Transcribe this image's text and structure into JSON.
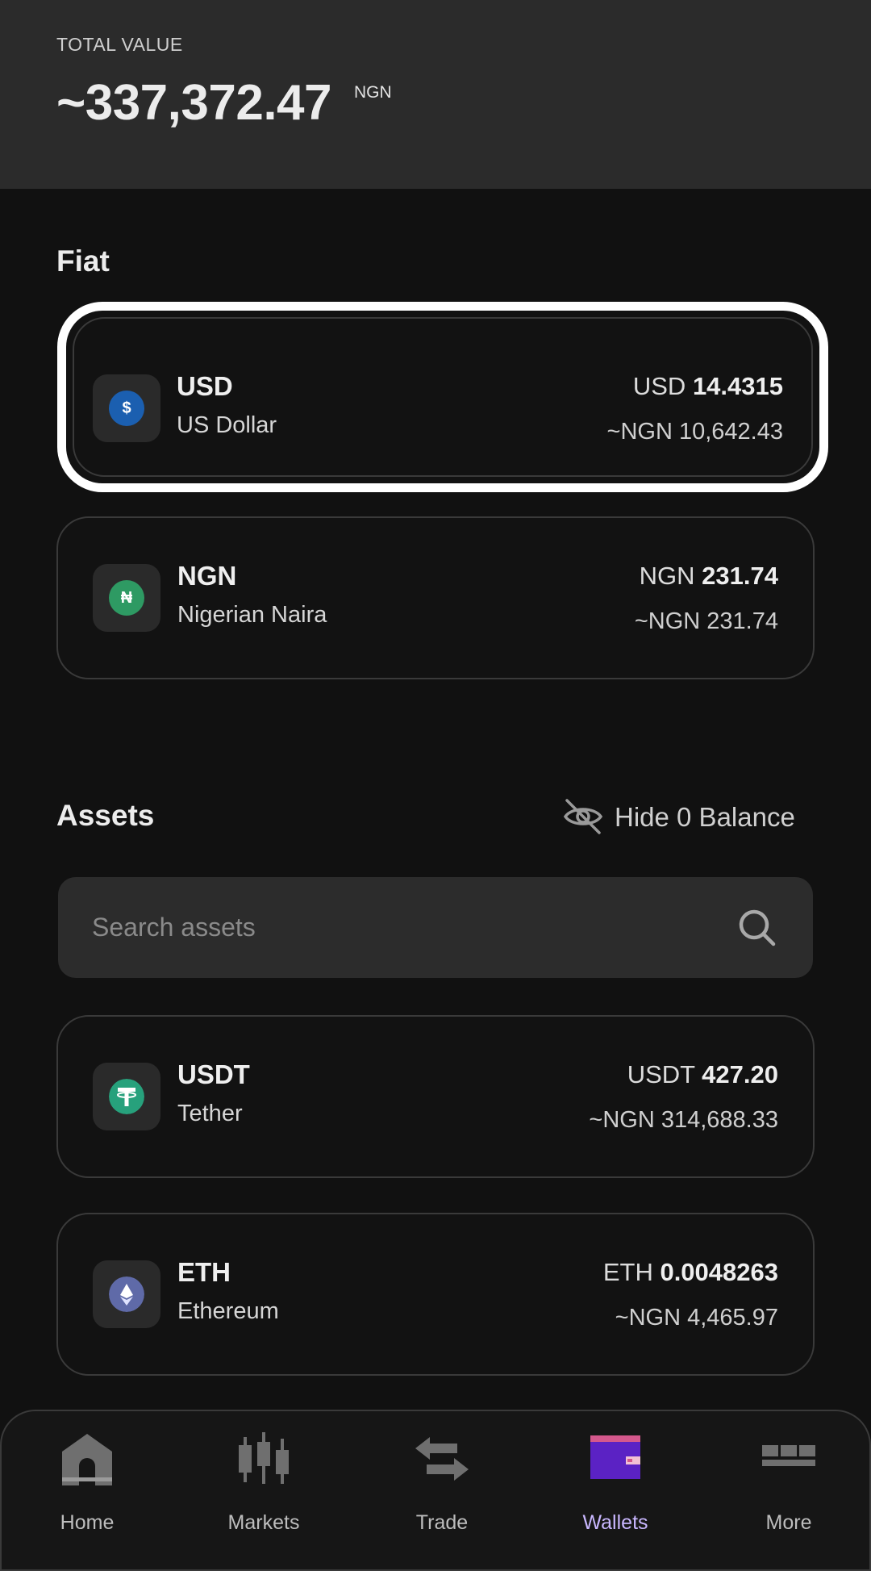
{
  "header": {
    "total_label": "TOTAL VALUE",
    "total_value": "~337,372.47",
    "total_unit": "NGN"
  },
  "fiat": {
    "title": "Fiat",
    "items": [
      {
        "symbol": "USD",
        "name": "US Dollar",
        "amount_unit": "USD",
        "amount": "14.4315",
        "approx": "~NGN 10,642.43",
        "icon": "dollar-coin-icon",
        "icon_glyph": "$",
        "color": "#1b5fb0"
      },
      {
        "symbol": "NGN",
        "name": "Nigerian Naira",
        "amount_unit": "NGN",
        "amount": "231.74",
        "approx": "~NGN 231.74",
        "icon": "naira-coin-icon",
        "icon_glyph": "₦",
        "color": "#2e9a63"
      }
    ]
  },
  "assets": {
    "title": "Assets",
    "hide_zero_label": "Hide 0 Balance",
    "search_placeholder": "Search assets",
    "items": [
      {
        "symbol": "USDT",
        "name": "Tether",
        "amount_unit": "USDT",
        "amount": "427.20",
        "approx": "~NGN 314,688.33",
        "icon": "tether-coin-icon",
        "color": "#27a17c"
      },
      {
        "symbol": "ETH",
        "name": "Ethereum",
        "amount_unit": "ETH",
        "amount": "0.0048263",
        "approx": "~NGN 4,465.97",
        "icon": "ethereum-coin-icon",
        "color": "#5f6aa8"
      }
    ]
  },
  "nav": {
    "items": [
      {
        "label": "Home",
        "icon": "home-icon"
      },
      {
        "label": "Markets",
        "icon": "markets-icon"
      },
      {
        "label": "Trade",
        "icon": "trade-icon"
      },
      {
        "label": "Wallets",
        "icon": "wallet-icon",
        "active": true
      },
      {
        "label": "More",
        "icon": "more-icon"
      }
    ],
    "active_color": "#c9b7ff"
  }
}
